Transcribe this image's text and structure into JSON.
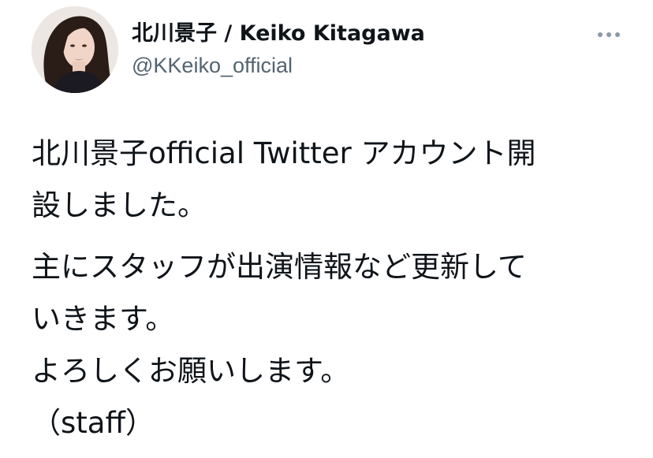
{
  "tweet": {
    "author": {
      "display_name": "北川景子 / Keiko Kitagawa",
      "handle": "@KKeiko_official",
      "avatar_icon": "profile-photo"
    },
    "more_icon": "more-horizontal-icon",
    "body": {
      "paragraph_1": {
        "line_1": "北川景子official Twitter アカウント開",
        "line_2": "設しました。"
      },
      "paragraph_2": {
        "line_1": "主にスタッフが出演情報など更新して",
        "line_2": "いきます。",
        "line_3": "よろしくお願いします。",
        "line_4": "（staff）"
      }
    }
  }
}
